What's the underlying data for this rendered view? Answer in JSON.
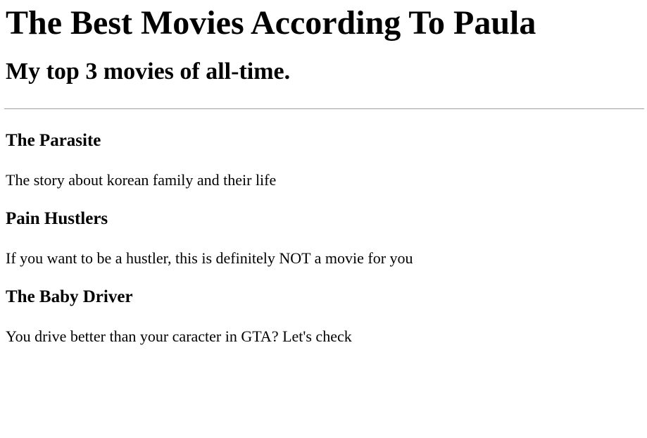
{
  "page": {
    "title": "The Best Movies According To Paula",
    "subtitle": "My top 3 movies of all-time."
  },
  "movies": [
    {
      "title": "The Parasite",
      "description": "The story about korean family and their life"
    },
    {
      "title": "Pain Hustlers",
      "description": "If you want to be a hustler, this is definitely NOT a movie for you"
    },
    {
      "title": "The Baby Driver",
      "description": "You drive better than your caracter in GTA? Let's check"
    }
  ]
}
